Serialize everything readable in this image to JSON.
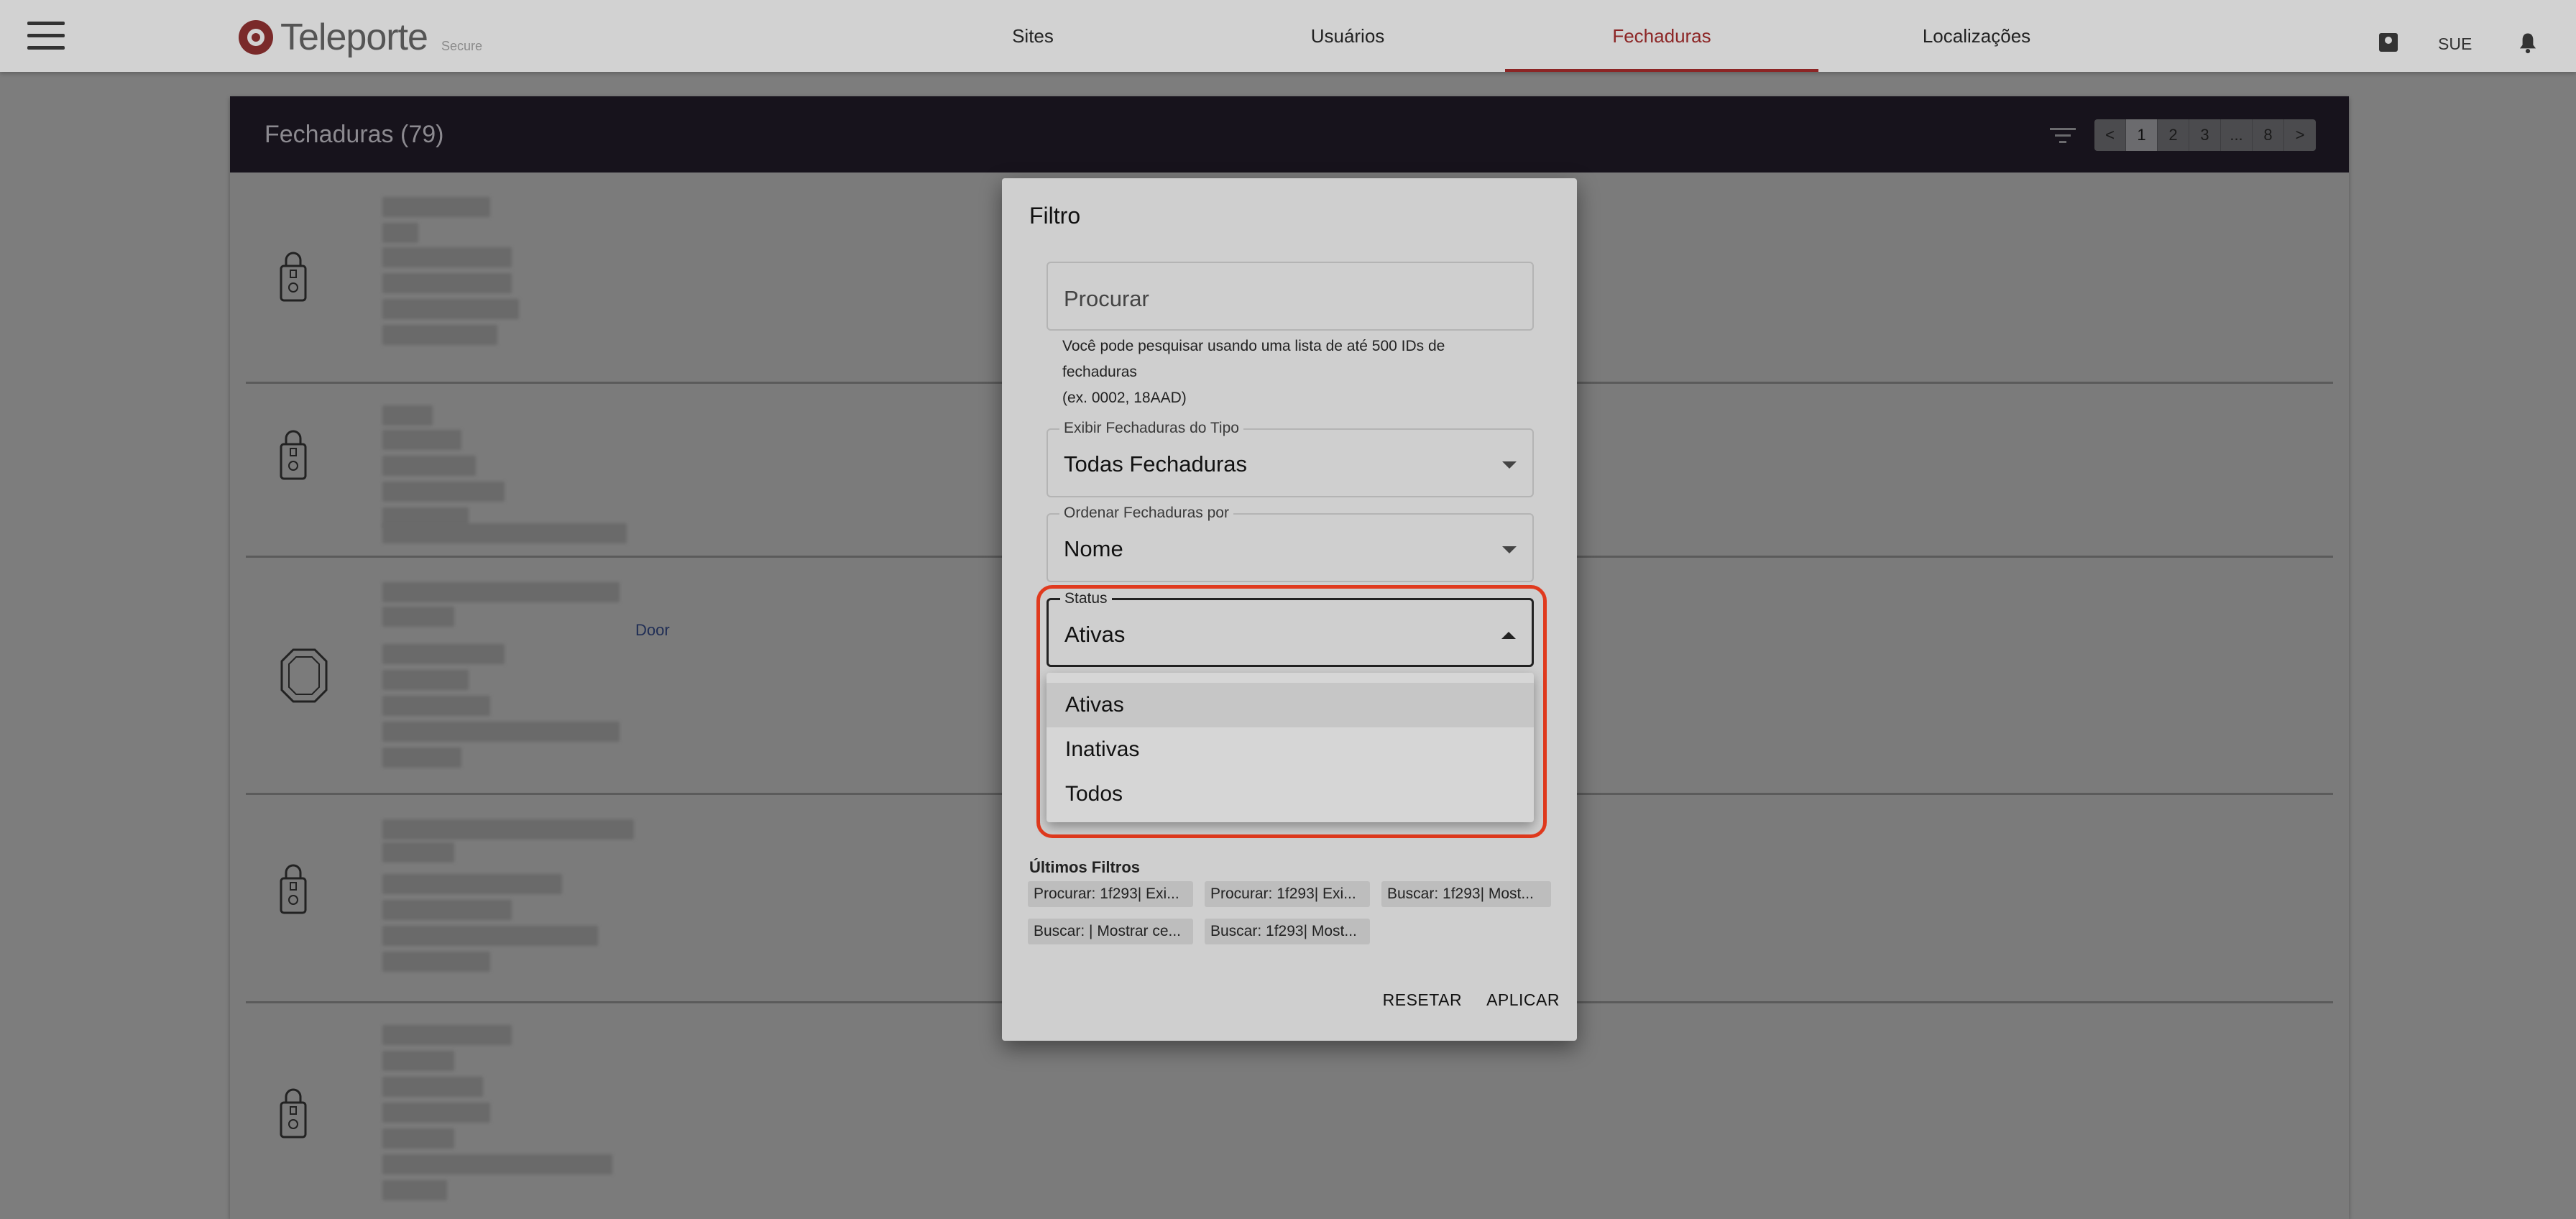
{
  "app": {
    "brand": "Teleporte",
    "brand_sub": "Secure"
  },
  "nav": {
    "items": [
      {
        "label": "Sites"
      },
      {
        "label": "Usuários"
      },
      {
        "label": "Fechaduras",
        "active": true
      },
      {
        "label": "Localizações"
      }
    ]
  },
  "user": {
    "label": "SUE"
  },
  "card": {
    "title": "Fechaduras (79)",
    "pagination": {
      "prev": "<",
      "pages": [
        "1",
        "2",
        "3",
        "...",
        "8"
      ],
      "current": "1",
      "next": ">"
    },
    "row_link": "Door"
  },
  "dialog": {
    "title": "Filtro",
    "search": {
      "placeholder": "Procurar"
    },
    "helper_text": {
      "line1": "Você pode pesquisar usando uma lista de até 500 IDs de",
      "line2": "fechaduras",
      "line3": "(ex. 0002, 18AAD)"
    },
    "type_field": {
      "label": "Exibir Fechaduras do Tipo",
      "value": "Todas Fechaduras"
    },
    "order_field": {
      "label": "Ordenar Fechaduras por",
      "value": "Nome"
    },
    "status_field": {
      "label": "Status",
      "value": "Ativas",
      "options": [
        "Ativas",
        "Inativas",
        "Todos"
      ]
    },
    "recent": {
      "title": "Últimos Filtros",
      "chips": [
        "Procurar: 1f293| Exi...",
        "Procurar: 1f293| Exi...",
        "Buscar: 1f293| Most...",
        "Buscar: | Mostrar ce...",
        "Buscar: 1f293| Most..."
      ]
    },
    "actions": {
      "reset": "RESETAR",
      "apply": "APLICAR"
    }
  },
  "colors": {
    "accent": "#8c2525",
    "highlight": "#e03a1e",
    "header_dark": "#17131c"
  },
  "icons": [
    "menu-icon",
    "logo-icon",
    "contact-icon",
    "bell-icon",
    "filter-icon",
    "lock-icon",
    "dropdown-arrow-icon"
  ]
}
